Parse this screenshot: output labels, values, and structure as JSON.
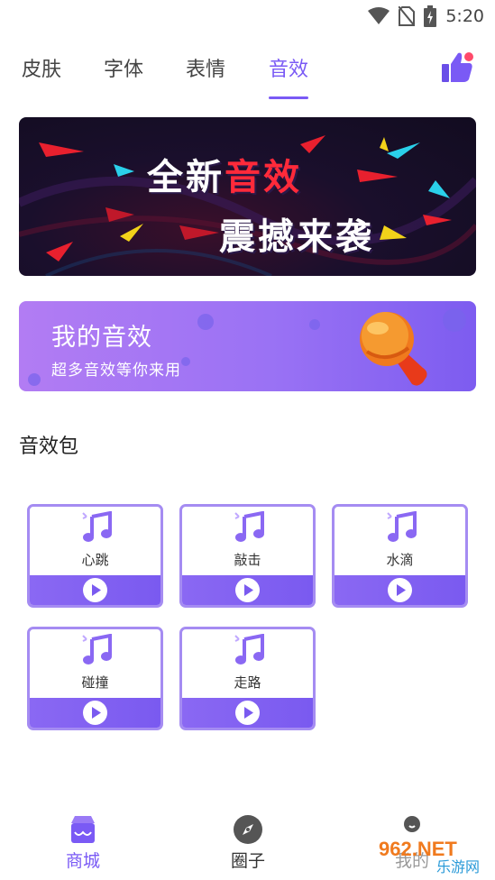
{
  "status_bar": {
    "time": "5:20",
    "icons": [
      "wifi-icon",
      "no-sim-icon",
      "battery-charging-icon"
    ]
  },
  "tabs": [
    {
      "label": "皮肤",
      "active": false
    },
    {
      "label": "字体",
      "active": false
    },
    {
      "label": "表情",
      "active": false
    },
    {
      "label": "音效",
      "active": true
    }
  ],
  "header": {
    "like_icon": "thumbs-up-icon"
  },
  "hero": {
    "line1_white": "全新",
    "line1_red": "音效",
    "line2": "震撼来袭"
  },
  "my_banner": {
    "title": "我的音效",
    "subtitle": "超多音效等你来用",
    "icon": "microphone-icon"
  },
  "section": {
    "title": "音效包"
  },
  "sound_packs": [
    {
      "name": "心跳"
    },
    {
      "name": "敲击"
    },
    {
      "name": "水滴"
    },
    {
      "name": "碰撞"
    },
    {
      "name": "走路"
    }
  ],
  "bottom_nav": [
    {
      "label": "商城",
      "icon": "shop-icon",
      "active": true
    },
    {
      "label": "圈子",
      "icon": "compass-icon",
      "active": false
    },
    {
      "label": "我的",
      "icon": "profile-icon",
      "active": false
    }
  ],
  "watermark": {
    "text_top": "962.NET",
    "text_bottom": "乐游网"
  },
  "colors": {
    "accent": "#7a5af5",
    "hero_red": "#ff2a3a",
    "card_border": "#a58cf2"
  }
}
